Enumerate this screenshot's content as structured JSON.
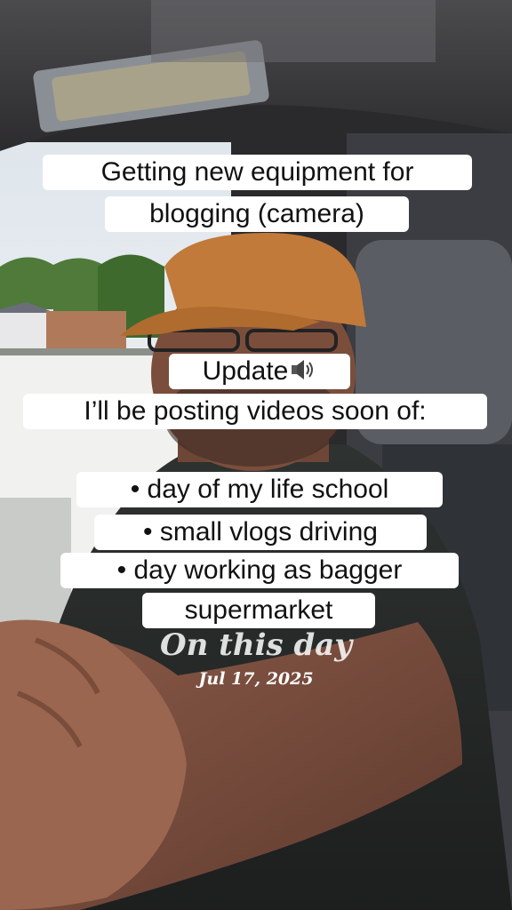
{
  "captions": {
    "line1": "Getting new equipment for",
    "line2": "blogging (camera)",
    "update": "Update",
    "line4": "I’ll be posting videos soon of:",
    "bullet1": "• day of my life school",
    "bullet2": "• small vlogs driving",
    "bullet3": "• day working as bagger",
    "bullet3b": "supermarket"
  },
  "memory": {
    "label": "On this day",
    "date": "Jul 17, 2025"
  },
  "icons": {
    "speaker": "speaker-loud-icon"
  },
  "colors": {
    "caption_bg": "#ffffff",
    "caption_text": "#111111",
    "cap_orange": "#c17a3a"
  }
}
